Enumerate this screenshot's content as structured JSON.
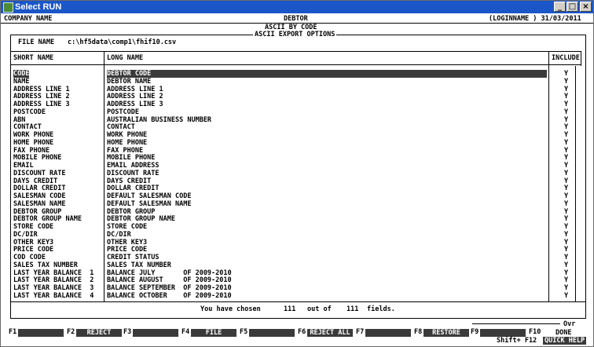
{
  "window": {
    "title": "Select RUN",
    "min": "_",
    "max": "□",
    "close": "×"
  },
  "header": {
    "company": "COMPANY NAME",
    "screen": "DEBTOR",
    "user_date": "(LOGINNAME ) 31/03/2011",
    "subtitle": "ASCII BY CODE"
  },
  "dialog": {
    "title": "ASCII EXPORT OPTIONS",
    "file_label": "FILE NAME",
    "file_value": "c:\\hf5data\\comp1\\fhif10.csv"
  },
  "columns": {
    "short": "SHORT NAME",
    "long": "LONG NAME",
    "include": "INCLUDE"
  },
  "rows": [
    {
      "short": "CODE",
      "long": "DEBTOR CODE",
      "inc": "Y"
    },
    {
      "short": "NAME",
      "long": "DEBTOR NAME",
      "inc": "Y"
    },
    {
      "short": "ADDRESS LINE 1",
      "long": "ADDRESS LINE 1",
      "inc": "Y"
    },
    {
      "short": "ADDRESS LINE 2",
      "long": "ADDRESS LINE 2",
      "inc": "Y"
    },
    {
      "short": "ADDRESS LINE 3",
      "long": "ADDRESS LINE 3",
      "inc": "Y"
    },
    {
      "short": "POSTCODE",
      "long": "POSTCODE",
      "inc": "Y"
    },
    {
      "short": "ABN",
      "long": "AUSTRALIAN BUSINESS NUMBER",
      "inc": "Y"
    },
    {
      "short": "CONTACT",
      "long": "CONTACT",
      "inc": "Y"
    },
    {
      "short": "WORK PHONE",
      "long": "WORK PHONE",
      "inc": "Y"
    },
    {
      "short": "HOME PHONE",
      "long": "HOME PHONE",
      "inc": "Y"
    },
    {
      "short": "FAX PHONE",
      "long": "FAX PHONE",
      "inc": "Y"
    },
    {
      "short": "MOBILE PHONE",
      "long": "MOBILE PHONE",
      "inc": "Y"
    },
    {
      "short": "EMAIL",
      "long": "EMAIL ADDRESS",
      "inc": "Y"
    },
    {
      "short": "DISCOUNT RATE",
      "long": "DISCOUNT RATE",
      "inc": "Y"
    },
    {
      "short": "DAYS CREDIT",
      "long": "DAYS CREDIT",
      "inc": "Y"
    },
    {
      "short": "DOLLAR CREDIT",
      "long": "DOLLAR CREDIT",
      "inc": "Y"
    },
    {
      "short": "SALESMAN CODE",
      "long": "DEFAULT SALESMAN CODE",
      "inc": "Y"
    },
    {
      "short": "SALESMAN NAME",
      "long": "DEFAULT SALESMAN NAME",
      "inc": "Y"
    },
    {
      "short": "DEBTOR GROUP",
      "long": "DEBTOR GROUP",
      "inc": "Y"
    },
    {
      "short": "DEBTOR GROUP NAME",
      "long": "DEBTOR GROUP NAME",
      "inc": "Y"
    },
    {
      "short": "STORE CODE",
      "long": "STORE CODE",
      "inc": "Y"
    },
    {
      "short": "DC/DIR",
      "long": "DC/DIR",
      "inc": "Y"
    },
    {
      "short": "OTHER KEY3",
      "long": "OTHER KEY3",
      "inc": "Y"
    },
    {
      "short": "PRICE CODE",
      "long": "PRICE CODE",
      "inc": "Y"
    },
    {
      "short": "COD CODE",
      "long": "CREDIT STATUS",
      "inc": "Y"
    },
    {
      "short": "SALES TAX NUMBER",
      "long": "SALES TAX NUMBER",
      "inc": "Y"
    },
    {
      "short": "LAST YEAR BALANCE  1",
      "long": "BALANCE JULY       OF 2009-2010",
      "inc": "Y"
    },
    {
      "short": "LAST YEAR BALANCE  2",
      "long": "BALANCE AUGUST     OF 2009-2010",
      "inc": "Y"
    },
    {
      "short": "LAST YEAR BALANCE  3",
      "long": "BALANCE SEPTEMBER  OF 2009-2010",
      "inc": "Y"
    },
    {
      "short": "LAST YEAR BALANCE  4",
      "long": "BALANCE OCTOBER    OF 2009-2010",
      "inc": "Y"
    }
  ],
  "status": {
    "prefix": "You have chosen",
    "chosen": "111",
    "mid": "out of",
    "total": "111",
    "suffix": "fields."
  },
  "fkeys": [
    {
      "key": "F1",
      "label": ""
    },
    {
      "key": "F2",
      "label": "REJECT"
    },
    {
      "key": "F3",
      "label": ""
    },
    {
      "key": "F4",
      "label": "FILE"
    },
    {
      "key": "F5",
      "label": ""
    },
    {
      "key": "F6",
      "label": "REJECT ALL"
    },
    {
      "key": "F7",
      "label": ""
    },
    {
      "key": "F8",
      "label": "RESTORE"
    },
    {
      "key": "F9",
      "label": ""
    },
    {
      "key": "F10",
      "label": "DONE"
    }
  ],
  "footer": {
    "ovr": "Ovr",
    "shift": "Shift+ F12",
    "quick_help": "QUICK HELP"
  }
}
